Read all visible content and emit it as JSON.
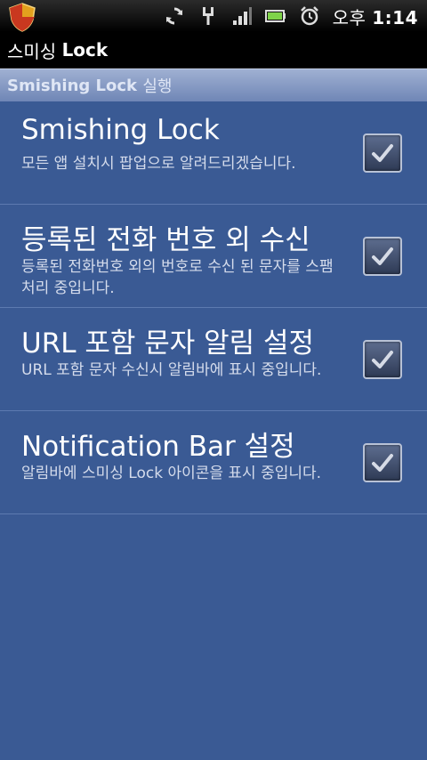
{
  "status_bar": {
    "time_prefix": "오후",
    "time": "1:14",
    "icons": [
      "shield-app-icon",
      "sync-icon",
      "usb-icon",
      "signal-icon",
      "battery-icon",
      "alarm-icon"
    ]
  },
  "app": {
    "title_part1": "스미싱",
    "title_part2": "Lock"
  },
  "category": {
    "label_bold": "Smishing Lock",
    "label_normal": "실행"
  },
  "preferences": [
    {
      "title": "Smishing Lock",
      "summary": "모든 앱 설치시 팝업으로 알려드리겠습니다.",
      "checked": true
    },
    {
      "title": "등록된 전화 번호 외 수신",
      "summary": "등록된 전화번호 외의 번호로 수신 된 문자를 스팸처리 중입니다.",
      "checked": true
    },
    {
      "title": "URL 포함 문자 알림 설정",
      "summary": "URL 포함 문자 수신시 알림바에 표시 중입니다.",
      "checked": true
    },
    {
      "title": "Notification Bar 설정",
      "summary": "알림바에 스미싱 Lock 아이콘을 표시 중입니다.",
      "checked": true
    }
  ],
  "colors": {
    "background": "#3a5a94",
    "category_header": "#8497c3",
    "divider": "#5d7ab0"
  }
}
